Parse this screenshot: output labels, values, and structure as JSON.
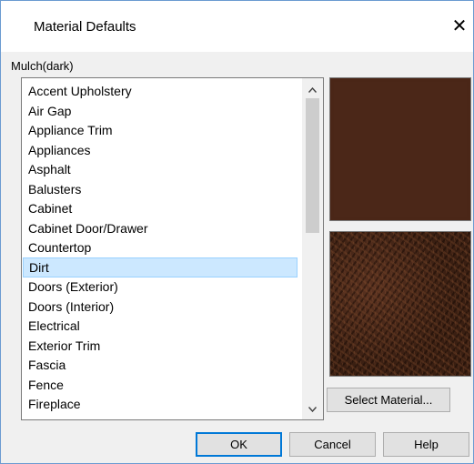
{
  "dialog": {
    "title": "Material Defaults",
    "close_label": "✕",
    "material_name": "Mulch(dark)"
  },
  "list": {
    "items": [
      "Accent Upholstery",
      "Air Gap",
      "Appliance Trim",
      "Appliances",
      "Asphalt",
      "Balusters",
      "Cabinet",
      "Cabinet Door/Drawer",
      "Countertop",
      "Dirt",
      "Doors (Exterior)",
      "Doors (Interior)",
      "Electrical",
      "Exterior Trim",
      "Fascia",
      "Fence",
      "Fireplace"
    ],
    "selected_index": 9,
    "scroll_up_icon": "^",
    "scroll_down_icon": "v"
  },
  "preview": {
    "swatch_color": "#4b2718",
    "texture_color": "#3a1f12"
  },
  "buttons": {
    "select_material": "Select Material...",
    "ok": "OK",
    "cancel": "Cancel",
    "help": "Help"
  }
}
